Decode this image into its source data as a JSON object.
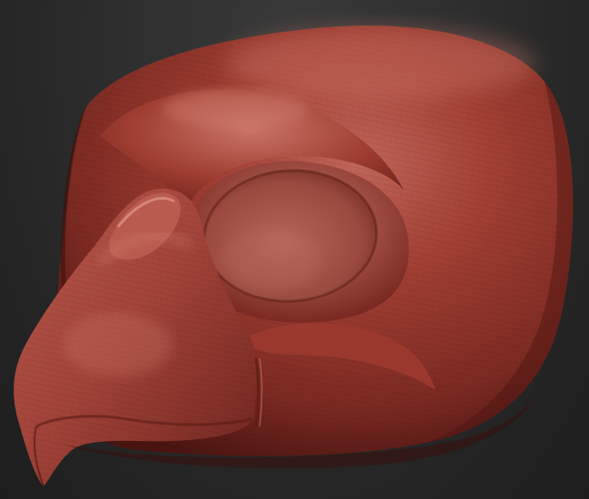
{
  "scene": {
    "background_color": "#2b2b2b",
    "model_color": "#8f3026",
    "highlight_color": "#c6685b",
    "shadow_color": "#4a1410",
    "render_style": "matcap clay sculpt"
  }
}
